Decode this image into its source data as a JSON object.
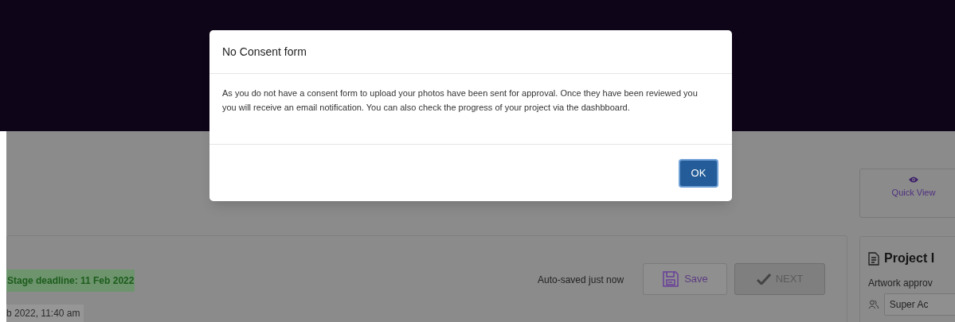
{
  "quick_view": {
    "label": "Quick View"
  },
  "stage": {
    "deadline": "Stage deadline: 11 Feb 2022",
    "date": "b 2022, 11:40 am",
    "autosave": "Auto-saved just now"
  },
  "buttons": [
    {
      "kind": "save",
      "label": "Save",
      "disabled": false
    },
    {
      "kind": "next",
      "label": "NEXT",
      "disabled": true
    }
  ],
  "project_panel": {
    "title": "Project I",
    "field_label": "Artwork approv",
    "select_value": "Super Ac"
  },
  "modal": {
    "title": "No Consent form",
    "message": "As you do not have a consent form to upload your photos have been sent for approval. Once they have been reviewed you you will receive an email notification. You can also check the progress of your project via the dashbboard.",
    "ok_button": "OK"
  }
}
